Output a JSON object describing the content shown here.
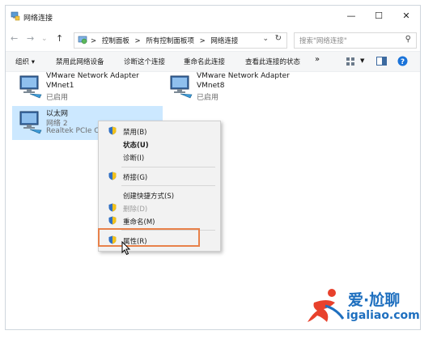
{
  "window": {
    "title": "网络连接",
    "controls": {
      "minimize": "—",
      "maximize": "☐",
      "close": "✕"
    }
  },
  "nav": {
    "back": "←",
    "forward": "→",
    "up": "↑"
  },
  "address": {
    "crumbs": [
      "控制面板",
      "所有控制面板项",
      "网络连接"
    ],
    "separator": ">",
    "dropdown": "⌄",
    "refresh": "↻"
  },
  "search": {
    "placeholder": "搜索\"网络连接\"",
    "icon": "search-icon"
  },
  "commands": {
    "organize": "组织 ▾",
    "disable": "禁用此网络设备",
    "diagnose": "诊断这个连接",
    "rename": "重命名此连接",
    "status": "查看此连接的状态",
    "more": "»"
  },
  "adapters": [
    {
      "name": "VMware Network Adapter",
      "sub": "VMnet1",
      "status": "已启用"
    },
    {
      "name": "VMware Network Adapter",
      "sub": "VMnet8",
      "status": "已启用"
    },
    {
      "name": "以太网",
      "sub": "网络 2",
      "status": "Realtek PCIe C"
    }
  ],
  "context_menu": {
    "items": [
      {
        "label": "禁用(B)",
        "shield": true
      },
      {
        "label": "状态(U)",
        "bold": true
      },
      {
        "label": "诊断(I)"
      },
      {
        "label": "桥接(G)",
        "shield": true
      },
      {
        "label": "创建快捷方式(S)"
      },
      {
        "label": "删除(D)",
        "shield": true,
        "disabled": true
      },
      {
        "label": "重命名(M)",
        "shield": true
      },
      {
        "label": "属性(R)",
        "shield": true
      }
    ]
  },
  "watermark": {
    "cn": "爱·尬聊",
    "en": "igaliao.com"
  },
  "colors": {
    "selection": "#cce8ff",
    "highlight_box": "#e8814a",
    "logo": "#1e6fbf",
    "help": "#1a73d9"
  }
}
